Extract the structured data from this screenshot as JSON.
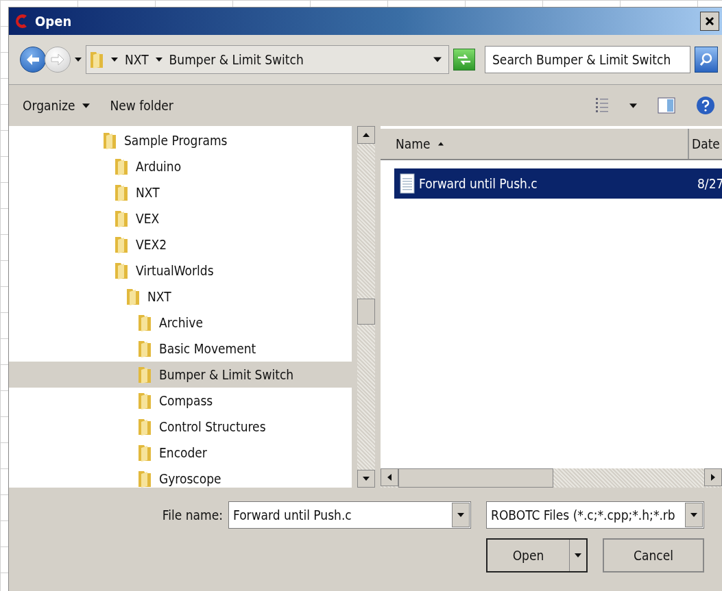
{
  "window": {
    "title": "Open"
  },
  "address": {
    "breadcrumbs": [
      "NXT",
      "Bumper & Limit Switch"
    ]
  },
  "search": {
    "placeholder": "Search Bumper & Limit Switch"
  },
  "toolbar": {
    "buttons": [
      {
        "label": "Organize",
        "kind": "menu"
      },
      {
        "label": "New folder",
        "kind": "plain"
      }
    ]
  },
  "tree": [
    {
      "label": "Sample Programs",
      "selected": false,
      "children": [
        {
          "label": "Arduino",
          "selected": false
        },
        {
          "label": "NXT",
          "selected": false
        },
        {
          "label": "VEX",
          "selected": false
        },
        {
          "label": "VEX2",
          "selected": false
        },
        {
          "label": "VirtualWorlds",
          "selected": false,
          "children": [
            {
              "label": "NXT",
              "selected": false,
              "children": [
                {
                  "label": "Archive",
                  "selected": false
                },
                {
                  "label": "Basic Movement",
                  "selected": false
                },
                {
                  "label": "Bumper & Limit Switch",
                  "selected": true
                },
                {
                  "label": "Compass",
                  "selected": false
                },
                {
                  "label": "Control Structures",
                  "selected": false
                },
                {
                  "label": "Encoder",
                  "selected": false
                },
                {
                  "label": "Gyroscope",
                  "selected": false
                }
              ]
            }
          ]
        }
      ]
    }
  ],
  "file_list": {
    "columns": [
      "Name",
      "Date"
    ],
    "rows": [
      {
        "name": "Forward until Push.c",
        "date": "8/27",
        "selected": true
      }
    ]
  },
  "file_name": {
    "label": "File name:",
    "value": "Forward until Push.c"
  },
  "file_type": {
    "value": "ROBOTC Files (*.c;*.cpp;*.h;*.rb"
  },
  "buttons": [
    {
      "label": "Open",
      "kind": "split"
    },
    {
      "label": "Cancel",
      "kind": "plain"
    }
  ]
}
